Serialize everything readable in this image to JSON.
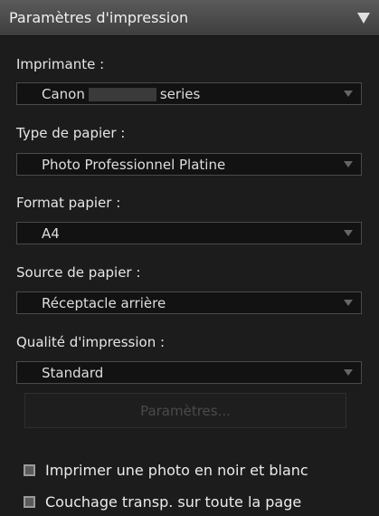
{
  "header": {
    "title": "Paramètres d'impression",
    "collapse_icon": "triangle-down-icon"
  },
  "printer": {
    "label": "Imprimante :",
    "value_prefix": "Canon",
    "value_suffix": "series"
  },
  "paper_type": {
    "label": "Type de papier :",
    "value": "Photo Professionnel Platine"
  },
  "paper_size": {
    "label": "Format papier :",
    "value": "A4"
  },
  "paper_source": {
    "label": "Source de papier :",
    "value": "Réceptacle arrière"
  },
  "print_quality": {
    "label": "Qualité d'impression :",
    "value": "Standard"
  },
  "settings_button": {
    "label": "Paramètres...",
    "disabled": true
  },
  "options": [
    {
      "label": "Imprimer une photo en noir et blanc",
      "checked": false
    },
    {
      "label": "Couchage transp. sur toute la page",
      "checked": false
    }
  ]
}
